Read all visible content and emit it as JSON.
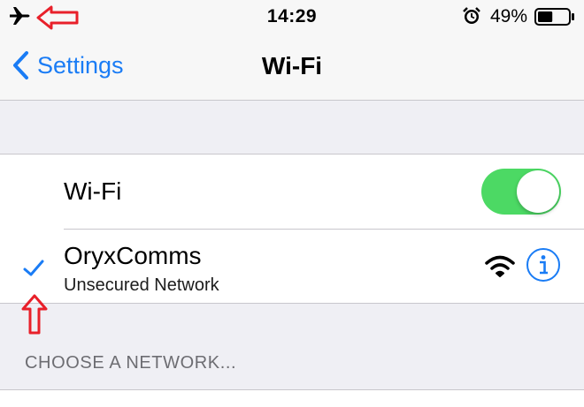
{
  "status_bar": {
    "time": "14:29",
    "battery_percent": "49%",
    "battery_level": 0.49,
    "icons": [
      "airplane-mode-icon",
      "alarm-icon",
      "battery-icon"
    ]
  },
  "annotations": {
    "arrow_color": "#e8202a",
    "arrows": [
      "left-arrow-annotation",
      "up-arrow-annotation"
    ]
  },
  "nav": {
    "back_label": "Settings",
    "title": "Wi-Fi"
  },
  "wifi": {
    "label": "Wi-Fi",
    "enabled": true,
    "toggle_color": "#4cd964"
  },
  "connected_network": {
    "name": "OryxComms",
    "subtitle": "Unsecured Network",
    "selected": true,
    "icons": [
      "checkmark-icon",
      "wifi-signal-icon",
      "info-icon"
    ]
  },
  "choose_network": {
    "header": "CHOOSE A NETWORK..."
  },
  "colors": {
    "accent": "#1a7cf5",
    "background": "#efeff4"
  }
}
